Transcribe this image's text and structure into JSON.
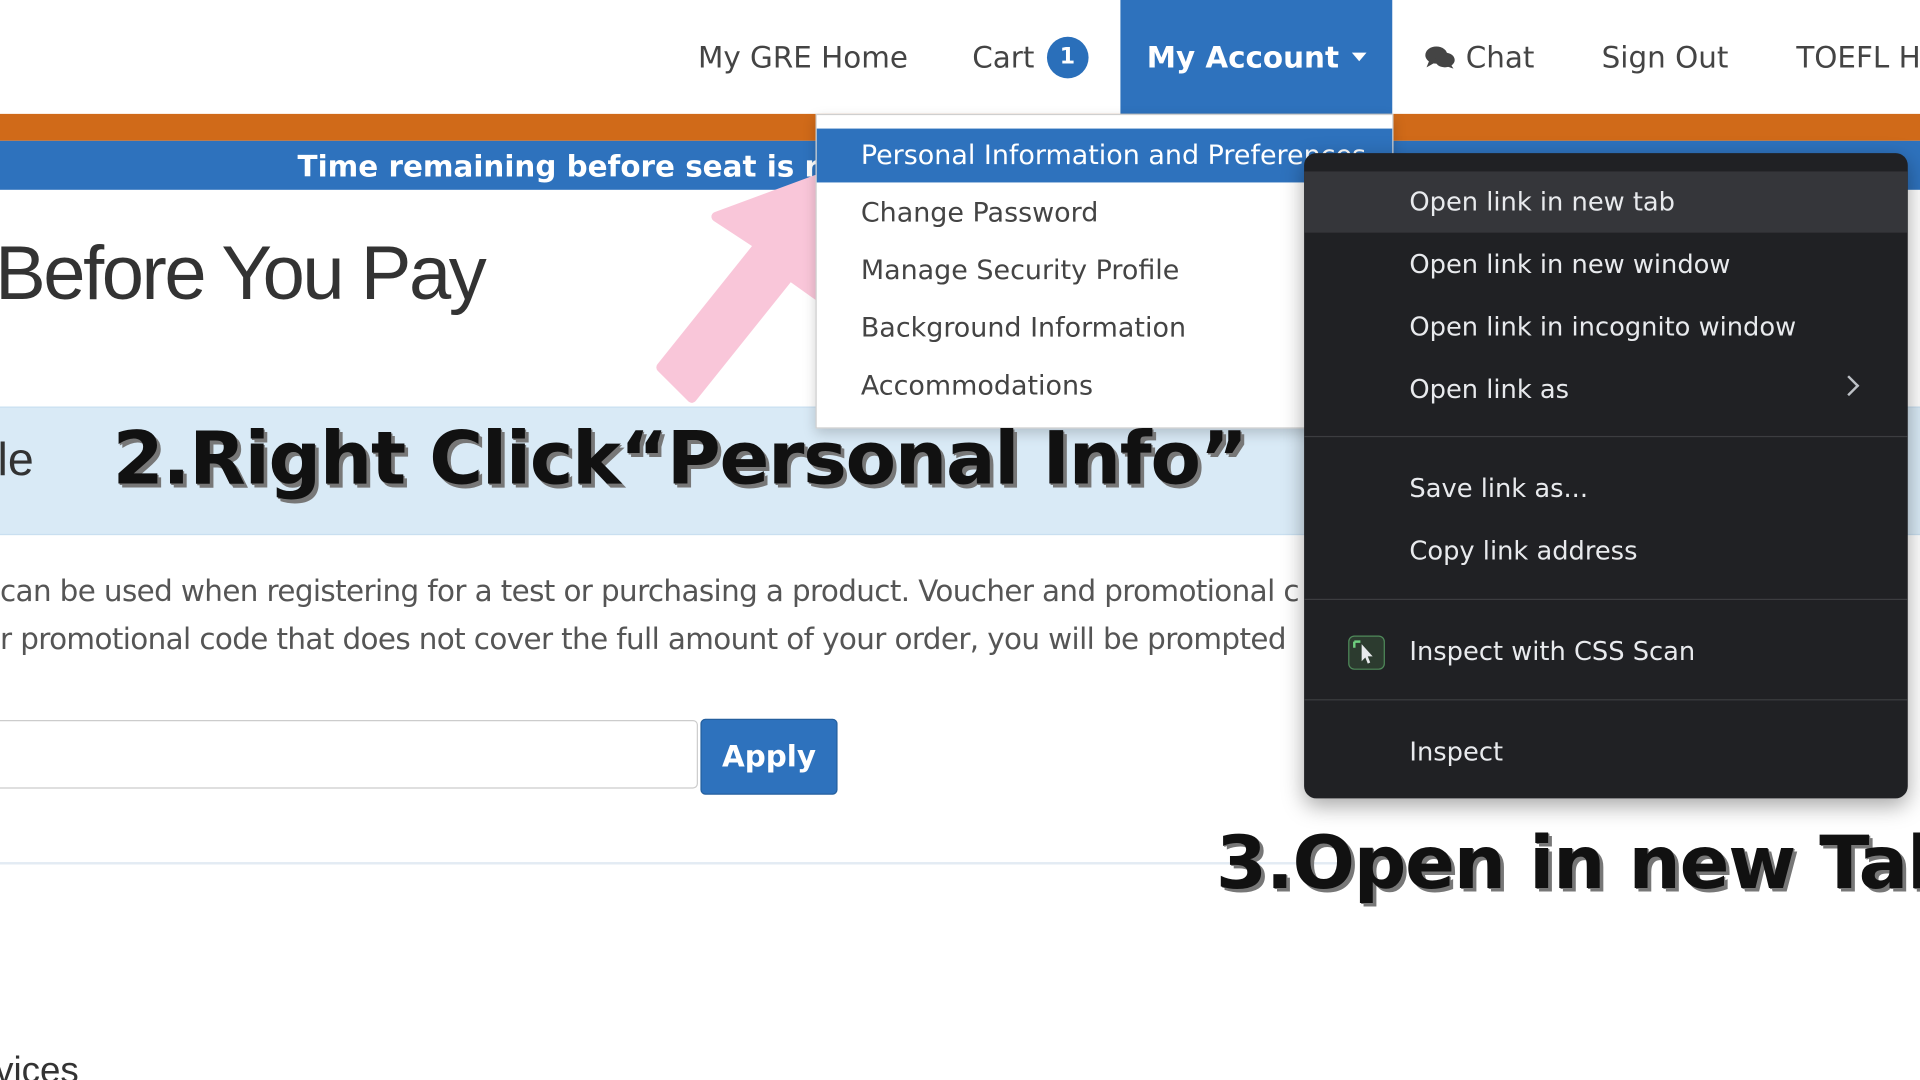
{
  "nav": {
    "home": "My GRE Home",
    "cart": "Cart",
    "cart_count": "1",
    "account": "My Account",
    "chat": "Chat",
    "signout": "Sign Out",
    "toefl": "TOEFL H"
  },
  "banner": {
    "timer_text": "Time remaining before seat is rele"
  },
  "page": {
    "title": "Before You Pay",
    "promo_label": "le",
    "para1": "can be used when registering for a test or purchasing a product. Voucher and promotional c",
    "para2": "r promotional code that does not cover the full amount of your order, you will be prompted",
    "code_input_value": "",
    "apply": "Apply",
    "services": "vices"
  },
  "account_menu": {
    "items": [
      {
        "label": "Personal Information and Preferences"
      },
      {
        "label": "Change Password"
      },
      {
        "label": "Manage Security Profile"
      },
      {
        "label": "Background Information"
      },
      {
        "label": "Accommodations"
      }
    ]
  },
  "context_menu": {
    "items": [
      {
        "label": "Open link in new tab"
      },
      {
        "label": "Open link in new window"
      },
      {
        "label": "Open link in incognito window"
      },
      {
        "label": "Open link as"
      },
      {
        "label": "Save link as..."
      },
      {
        "label": "Copy link address"
      },
      {
        "label": "Inspect with CSS Scan"
      },
      {
        "label": "Inspect"
      }
    ]
  },
  "annotations": {
    "step2": "2.Right Click“Personal Info”",
    "step3": "3.Open in new Tab"
  },
  "colors": {
    "primary_blue": "#2e72bd",
    "orange_bar": "#d06a19",
    "promo_band": "#d9eaf6",
    "context_bg": "#202124",
    "arrow_pink": "#f9c6d9"
  },
  "icons": {
    "chat": "chat-bubbles-icon",
    "caret": "caret-down-icon",
    "submenu": "chevron-right-icon",
    "css_scan": "css-scan-icon",
    "pointer": "pink-arrow-annotation"
  }
}
